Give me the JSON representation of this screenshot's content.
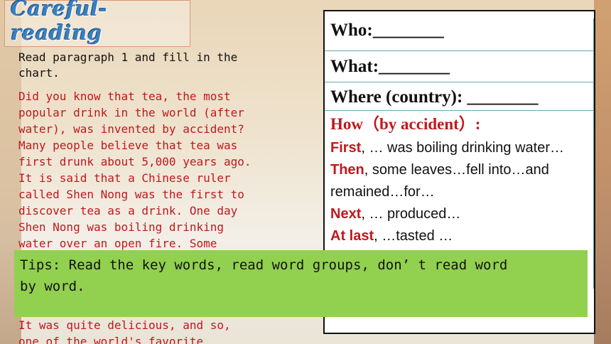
{
  "title": "Careful-\nreading",
  "instruction": "Read paragraph 1 and fill in the\nchart.",
  "paragraph": "Did you know that tea, the most\npopular drink in the world (after\nwater), was invented by accident?\nMany people believe that tea was\nfirst drunk about 5,000 years ago.\nIt is said that a Chinese ruler\ncalled Shen Nong was the first to\ndiscover tea as a drink. One day\nShen Nong was boiling drinking\nwater over an open fire. Some\nleaves from a tea plant fell into\nthe water and remained there for\nsome time. It produced a nice smell,\nso he tasted the brown water.\nIt was quite delicious, and so,\none of the world's favorite",
  "chart": {
    "who": "Who:________",
    "what": "What:________",
    "where": "Where (country): ________",
    "how": "How（by accident）:",
    "steps": [
      {
        "kw": "First",
        "rest": ", … was boiling drinking water…"
      },
      {
        "kw": "Then",
        "rest": ", some leaves…fell into…and remained…for…"
      },
      {
        "kw": "Next",
        "rest": ", … produced…"
      },
      {
        "kw": "At last",
        "rest": ", …tasted …"
      }
    ]
  },
  "tips": "Tips: Read the key words, read word groups, don’ t read word\nby word.",
  "colors": {
    "accent_red": "#c0181c",
    "tips_green": "#92d050",
    "title_blue": "#3a7fc0"
  }
}
